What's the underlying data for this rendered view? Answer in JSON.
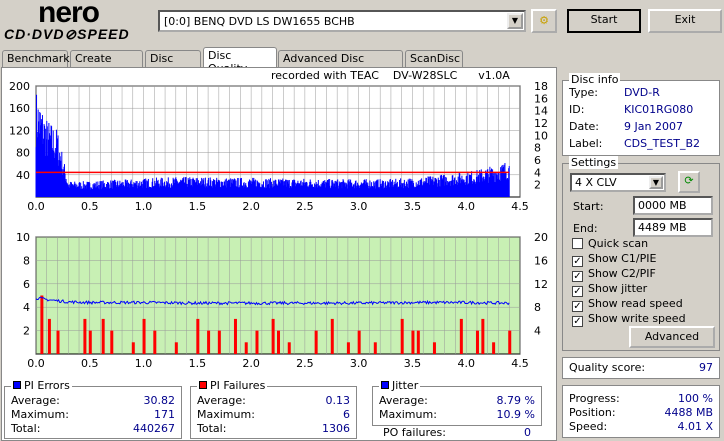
{
  "app": {
    "logo_top": "nero",
    "logo_bottom": "CD·DVD⊘SPEED"
  },
  "drive": {
    "selected": "[0:0]  BENQ DVD LS DW1655 BCHB"
  },
  "buttons": {
    "start": "Start",
    "exit": "Exit",
    "advanced": "Advanced"
  },
  "tabs": [
    {
      "label": "Benchmark"
    },
    {
      "label": "Create Disc"
    },
    {
      "label": "Disc Info"
    },
    {
      "label": "Disc Quality",
      "active": true
    },
    {
      "label": "Advanced Disc Quality"
    },
    {
      "label": "ScanDisc"
    }
  ],
  "recorded": {
    "prefix": "recorded with TEAC",
    "model": "DV-W28SLC",
    "version": "v1.0A"
  },
  "disc_info": {
    "title": "Disc info",
    "rows": [
      {
        "label": "Type:",
        "value": "DVD-R"
      },
      {
        "label": "ID:",
        "value": "KIC01RG080"
      },
      {
        "label": "Date:",
        "value": "9 Jan 2007"
      },
      {
        "label": "Label:",
        "value": "CDS_TEST_B2"
      }
    ]
  },
  "settings": {
    "title": "Settings",
    "speed": "4 X CLV",
    "start_label": "Start:",
    "start_value": "0000 MB",
    "end_label": "End:",
    "end_value": "4489 MB",
    "checks": [
      {
        "label": "Quick scan",
        "checked": false
      },
      {
        "label": "Show C1/PIE",
        "checked": true
      },
      {
        "label": "Show C2/PIF",
        "checked": true
      },
      {
        "label": "Show jitter",
        "checked": true
      },
      {
        "label": "Show read speed",
        "checked": true
      },
      {
        "label": "Show write speed",
        "checked": true
      }
    ]
  },
  "quality": {
    "label": "Quality score:",
    "value": "97"
  },
  "progress": {
    "rows": [
      {
        "label": "Progress:",
        "value": "100 %"
      },
      {
        "label": "Position:",
        "value": "4488 MB"
      },
      {
        "label": "Speed:",
        "value": "4.01 X"
      }
    ]
  },
  "pi_errors": {
    "title": "PI Errors",
    "color": "#0000ff",
    "rows": [
      {
        "label": "Average:",
        "value": "30.82"
      },
      {
        "label": "Maximum:",
        "value": "171"
      },
      {
        "label": "Total:",
        "value": "440267"
      }
    ]
  },
  "pi_failures": {
    "title": "PI Failures",
    "color": "#ff0000",
    "rows": [
      {
        "label": "Average:",
        "value": "0.13"
      },
      {
        "label": "Maximum:",
        "value": "6"
      },
      {
        "label": "Total:",
        "value": "1306"
      }
    ]
  },
  "jitter": {
    "title": "Jitter",
    "color": "#0000ff",
    "rows": [
      {
        "label": "Average:",
        "value": "8.79 %"
      },
      {
        "label": "Maximum:",
        "value": "10.9 %"
      }
    ]
  },
  "po_failures": {
    "label": "PO failures:",
    "value": "0"
  },
  "chart_data": [
    {
      "type": "bar",
      "name": "PI Errors",
      "xlim": [
        0,
        4.5
      ],
      "ylim": [
        0,
        200
      ],
      "y2lim": [
        0,
        18
      ],
      "xticks": [
        "0.0",
        "0.5",
        "1.0",
        "1.5",
        "2.0",
        "2.5",
        "3.0",
        "3.5",
        "4.0",
        "4.5"
      ],
      "yticks": [
        "40",
        "80",
        "120",
        "160",
        "200"
      ],
      "y2ticks": [
        "2",
        "4",
        "6",
        "8",
        "10",
        "12",
        "14",
        "16",
        "18"
      ],
      "x": [
        0,
        0.1,
        0.2,
        0.3,
        0.4,
        0.5,
        0.6,
        0.7,
        0.8,
        0.9,
        1.0,
        1.1,
        1.2,
        1.3,
        1.4,
        1.5,
        1.6,
        1.7,
        1.8,
        1.9,
        2.0,
        2.1,
        2.2,
        2.3,
        2.4,
        2.5,
        2.6,
        2.7,
        2.8,
        2.9,
        3.0,
        3.1,
        3.2,
        3.3,
        3.4,
        3.5,
        3.6,
        3.7,
        3.8,
        3.9,
        4.0,
        4.1,
        4.2,
        4.3,
        4.4
      ],
      "values": [
        150,
        110,
        95,
        22,
        22,
        22,
        23,
        24,
        24,
        25,
        26,
        27,
        27,
        28,
        28,
        28,
        28,
        27,
        27,
        27,
        27,
        27,
        26,
        26,
        26,
        26,
        26,
        25,
        25,
        25,
        25,
        25,
        25,
        25,
        26,
        27,
        28,
        30,
        32,
        34,
        36,
        38,
        42,
        46,
        52
      ],
      "read_speed": 4.0,
      "read_speed_color": "#ff0000",
      "bar_color": "#0000ff"
    },
    {
      "type": "bar",
      "name": "PI Failures / Jitter",
      "xlim": [
        0,
        4.5
      ],
      "ylim": [
        0,
        10
      ],
      "y2lim": [
        0,
        20
      ],
      "xticks": [
        "0.0",
        "0.5",
        "1.0",
        "1.5",
        "2.0",
        "2.5",
        "3.0",
        "3.5",
        "4.0",
        "4.5"
      ],
      "yticks": [
        "2",
        "4",
        "6",
        "8",
        "10"
      ],
      "y2ticks": [
        "4",
        "8",
        "12",
        "16",
        "20"
      ],
      "pif": [
        [
          0.05,
          5
        ],
        [
          0.12,
          3
        ],
        [
          0.2,
          2
        ],
        [
          0.45,
          3
        ],
        [
          0.5,
          2
        ],
        [
          0.62,
          3
        ],
        [
          0.7,
          2
        ],
        [
          0.9,
          1
        ],
        [
          1.0,
          3
        ],
        [
          1.1,
          2
        ],
        [
          1.3,
          1
        ],
        [
          1.5,
          3
        ],
        [
          1.6,
          2
        ],
        [
          1.7,
          2
        ],
        [
          1.85,
          3
        ],
        [
          1.95,
          1
        ],
        [
          2.05,
          2
        ],
        [
          2.2,
          3
        ],
        [
          2.25,
          2
        ],
        [
          2.35,
          1
        ],
        [
          2.6,
          2
        ],
        [
          2.75,
          3
        ],
        [
          2.9,
          1
        ],
        [
          3.0,
          2
        ],
        [
          3.15,
          1
        ],
        [
          3.4,
          3
        ],
        [
          3.5,
          2
        ],
        [
          3.55,
          2
        ],
        [
          3.7,
          1
        ],
        [
          3.95,
          3
        ],
        [
          4.1,
          2
        ],
        [
          4.15,
          3
        ],
        [
          4.25,
          1
        ],
        [
          4.4,
          2
        ]
      ],
      "jitter_x": [
        0,
        0.1,
        0.2,
        0.3,
        0.5,
        1.0,
        1.5,
        2.0,
        2.5,
        3.0,
        3.5,
        4.0,
        4.4
      ],
      "jitter": [
        9.6,
        9.3,
        9.1,
        8.9,
        8.8,
        8.8,
        8.7,
        8.7,
        8.7,
        8.7,
        8.8,
        8.8,
        8.7
      ],
      "bg_color": "#c8f0b4",
      "pif_color": "#ff0000",
      "jitter_color": "#0000ff"
    }
  ]
}
